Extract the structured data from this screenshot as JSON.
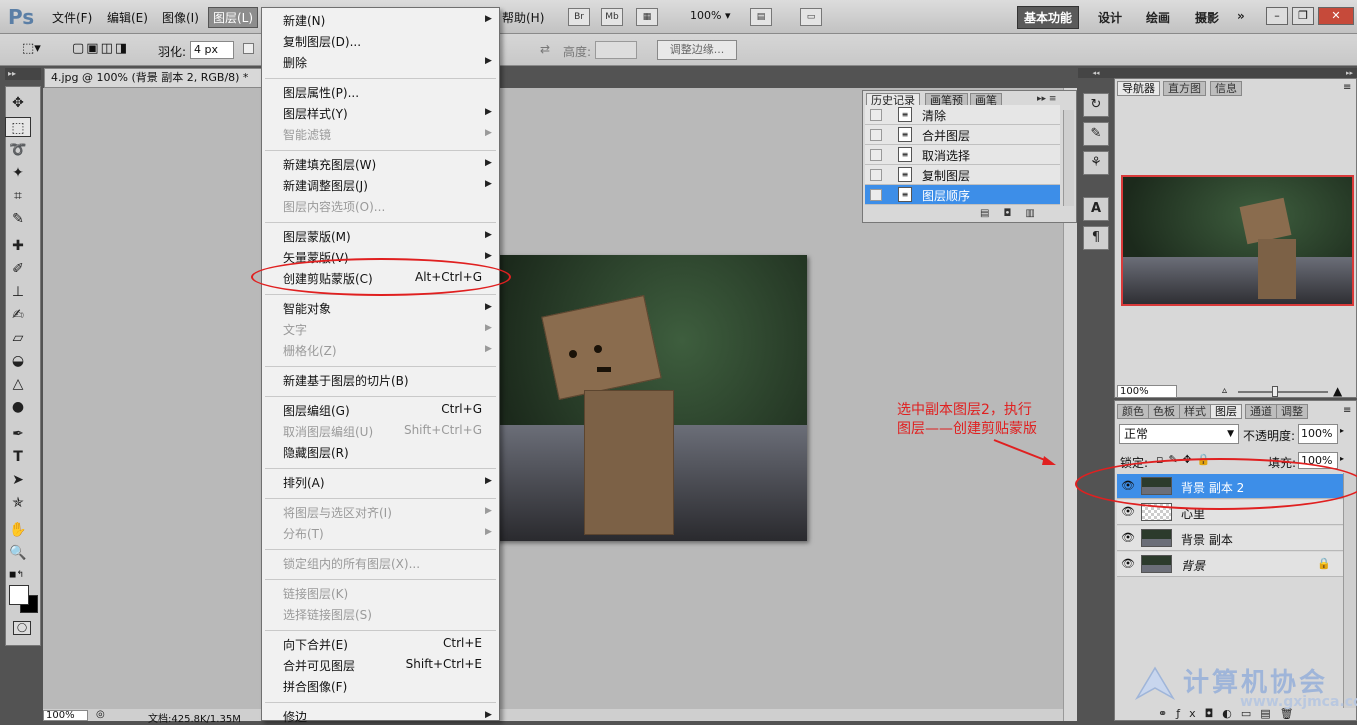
{
  "menubar": {
    "logo": "Ps",
    "items": [
      "文件(F)",
      "编辑(E)",
      "图像(I)",
      "图层(L)"
    ],
    "help": "帮助(H)",
    "bridge": "Br",
    "minibridge": "Mb",
    "zoom": "100%",
    "workspaces": [
      "基本功能",
      "设计",
      "绘画",
      "摄影"
    ],
    "more": "»"
  },
  "options": {
    "feather_label": "羽化:",
    "feather_value": "4 px",
    "height_label": "高度:",
    "refine_edge": "调整边缘..."
  },
  "document": {
    "tab_title": "4.jpg @ 100% (背景 副本 2, RGB/8) *",
    "status_zoom": "100%",
    "status_doc": "文档:425.8K/1.35M"
  },
  "dropdown": {
    "groups": [
      [
        {
          "label": "新建(N)",
          "shortcut": "",
          "sub": true,
          "dis": false
        },
        {
          "label": "复制图层(D)...",
          "shortcut": "",
          "sub": false,
          "dis": false
        },
        {
          "label": "删除",
          "shortcut": "",
          "sub": true,
          "dis": false
        }
      ],
      [
        {
          "label": "图层属性(P)...",
          "shortcut": "",
          "sub": false,
          "dis": false
        },
        {
          "label": "图层样式(Y)",
          "shortcut": "",
          "sub": true,
          "dis": false
        },
        {
          "label": "智能滤镜",
          "shortcut": "",
          "sub": true,
          "dis": true
        }
      ],
      [
        {
          "label": "新建填充图层(W)",
          "shortcut": "",
          "sub": true,
          "dis": false
        },
        {
          "label": "新建调整图层(J)",
          "shortcut": "",
          "sub": true,
          "dis": false
        },
        {
          "label": "图层内容选项(O)...",
          "shortcut": "",
          "sub": false,
          "dis": true
        }
      ],
      [
        {
          "label": "图层蒙版(M)",
          "shortcut": "",
          "sub": true,
          "dis": false
        },
        {
          "label": "矢量蒙版(V)",
          "shortcut": "",
          "sub": true,
          "dis": false
        },
        {
          "label": "创建剪贴蒙版(C)",
          "shortcut": "Alt+Ctrl+G",
          "sub": false,
          "dis": false
        }
      ],
      [
        {
          "label": "智能对象",
          "shortcut": "",
          "sub": true,
          "dis": false
        },
        {
          "label": "文字",
          "shortcut": "",
          "sub": true,
          "dis": true
        },
        {
          "label": "栅格化(Z)",
          "shortcut": "",
          "sub": true,
          "dis": true
        }
      ],
      [
        {
          "label": "新建基于图层的切片(B)",
          "shortcut": "",
          "sub": false,
          "dis": false
        }
      ],
      [
        {
          "label": "图层编组(G)",
          "shortcut": "Ctrl+G",
          "sub": false,
          "dis": false
        },
        {
          "label": "取消图层编组(U)",
          "shortcut": "Shift+Ctrl+G",
          "sub": false,
          "dis": true
        },
        {
          "label": "隐藏图层(R)",
          "shortcut": "",
          "sub": false,
          "dis": false
        }
      ],
      [
        {
          "label": "排列(A)",
          "shortcut": "",
          "sub": true,
          "dis": false
        }
      ],
      [
        {
          "label": "将图层与选区对齐(I)",
          "shortcut": "",
          "sub": true,
          "dis": true
        },
        {
          "label": "分布(T)",
          "shortcut": "",
          "sub": true,
          "dis": true
        }
      ],
      [
        {
          "label": "锁定组内的所有图层(X)...",
          "shortcut": "",
          "sub": false,
          "dis": true
        }
      ],
      [
        {
          "label": "链接图层(K)",
          "shortcut": "",
          "sub": false,
          "dis": true
        },
        {
          "label": "选择链接图层(S)",
          "shortcut": "",
          "sub": false,
          "dis": true
        }
      ],
      [
        {
          "label": "向下合并(E)",
          "shortcut": "Ctrl+E",
          "sub": false,
          "dis": false
        },
        {
          "label": "合并可见图层",
          "shortcut": "Shift+Ctrl+E",
          "sub": false,
          "dis": false
        },
        {
          "label": "拼合图像(F)",
          "shortcut": "",
          "sub": false,
          "dis": false
        }
      ],
      [
        {
          "label": "修边",
          "shortcut": "",
          "sub": true,
          "dis": false
        }
      ]
    ]
  },
  "history": {
    "tabs": [
      "历史记录",
      "画笔预",
      "画笔"
    ],
    "rows": [
      "清除",
      "合并图层",
      "取消选择",
      "复制图层",
      "图层顺序"
    ],
    "selected": 4
  },
  "navigator": {
    "tabs": [
      "导航器",
      "直方图",
      "信息"
    ],
    "zoom": "100%"
  },
  "layers": {
    "tabs": [
      "颜色",
      "色板",
      "样式",
      "图层",
      "通道",
      "调整"
    ],
    "blend_mode": "正常",
    "opacity_label": "不透明度:",
    "opacity": "100%",
    "lock_label": "锁定:",
    "fill_label": "填充:",
    "fill": "100%",
    "items": [
      {
        "name": "背景 副本 2",
        "selected": true,
        "transparent": false,
        "locked": false
      },
      {
        "name": "心里",
        "selected": false,
        "transparent": true,
        "locked": false
      },
      {
        "name": "背景 副本",
        "selected": false,
        "transparent": false,
        "locked": false
      },
      {
        "name": "背景",
        "selected": false,
        "transparent": false,
        "locked": true
      }
    ]
  },
  "annotation": {
    "line1": "选中副本图层2，执行",
    "line2": "图层——创建剪贴蒙版"
  },
  "watermark": {
    "text": "计算机协会",
    "url": "www.gxjmca.com"
  },
  "colors": {
    "accent": "#3d8ee8",
    "annotation": "#e02020",
    "canvas_bg": "#b9b9b9"
  }
}
